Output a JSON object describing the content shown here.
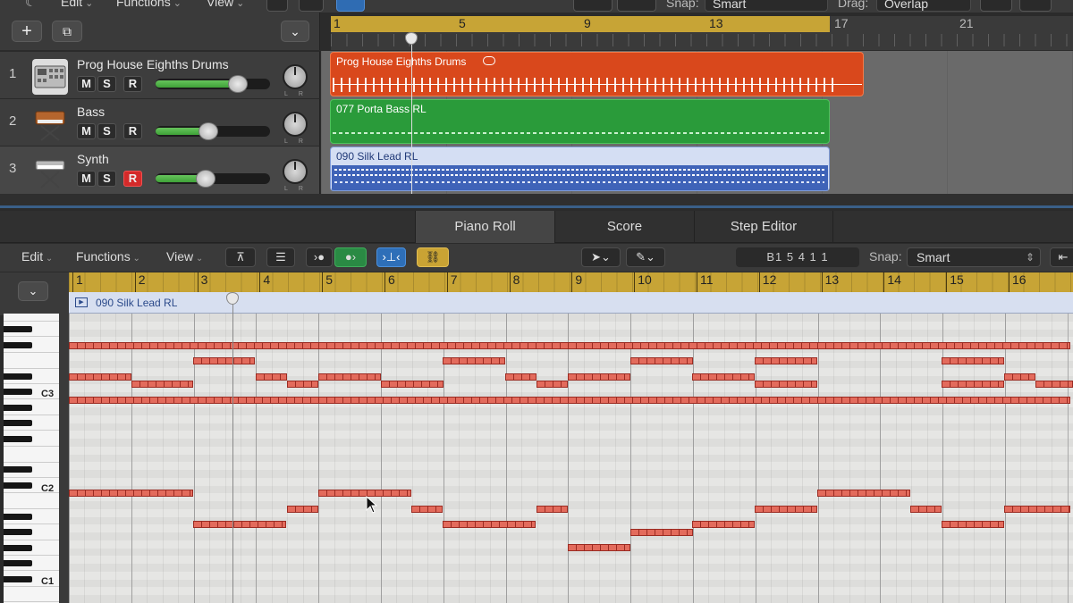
{
  "top_toolbar": {
    "edit_menu": "Edit",
    "functions_menu": "Functions",
    "view_menu": "View",
    "snap_label": "Snap:",
    "snap_value": "Smart",
    "drag_label": "Drag:",
    "drag_value": "Overlap"
  },
  "arrange_ruler": {
    "bars": [
      "1",
      "5",
      "9",
      "13",
      "17",
      "21"
    ]
  },
  "tracks": [
    {
      "num": "1",
      "name": "Prog House Eighths Drums",
      "mute": "M",
      "solo": "S",
      "rec": "R",
      "volume_fraction": 0.72,
      "rec_armed": false
    },
    {
      "num": "2",
      "name": "Bass",
      "mute": "M",
      "solo": "S",
      "rec": "R",
      "volume_fraction": 0.46,
      "rec_armed": false
    },
    {
      "num": "3",
      "name": "Synth",
      "mute": "M",
      "solo": "S",
      "rec": "R",
      "volume_fraction": 0.44,
      "rec_armed": true
    }
  ],
  "regions": {
    "drums": "Prog House Eighths Drums",
    "bass": "077 Porta Bass RL",
    "synth": "090 Silk Lead RL"
  },
  "editor_tabs": [
    "Piano Roll",
    "Score",
    "Step Editor"
  ],
  "editor_toolbar": {
    "edit_menu": "Edit",
    "functions_menu": "Functions",
    "view_menu": "View",
    "position": "B1  5 4 1 1",
    "snap_label": "Snap:",
    "snap_value": "Smart"
  },
  "piano_roll": {
    "bars": [
      "1",
      "2",
      "3",
      "4",
      "5",
      "6",
      "7",
      "8",
      "9",
      "10",
      "11",
      "12",
      "13",
      "14",
      "15",
      "16"
    ],
    "region_name": "090 Silk Lead RL",
    "octave_labels": [
      "C3",
      "C2",
      "C1"
    ]
  },
  "colors": {
    "drums_region": "#d9481c",
    "bass_region": "#2a9b3a",
    "synth_region": "#d4def3",
    "cycle": "#c7a436",
    "note": "#e36b5c"
  }
}
